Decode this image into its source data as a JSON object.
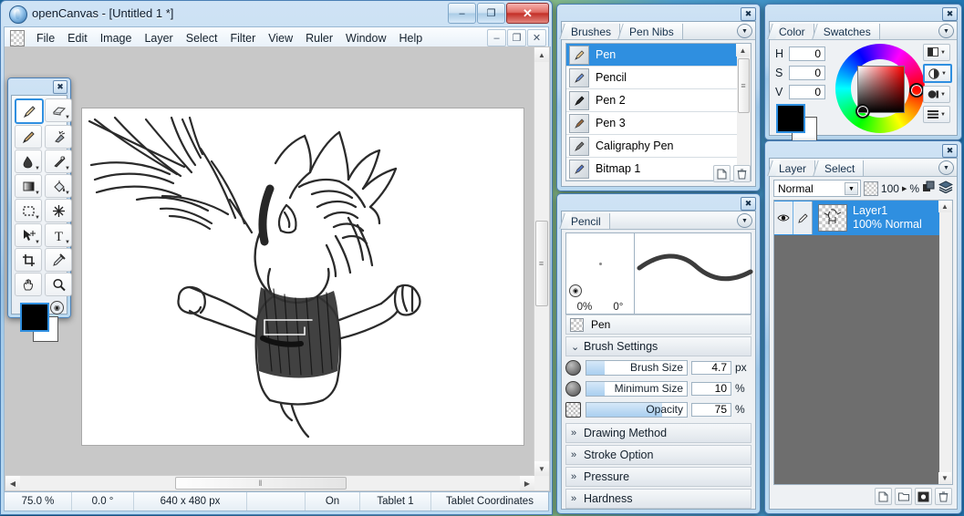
{
  "app": {
    "title": "openCanvas - [Untitled 1 *]",
    "icon": "opencanvas-logo-icon"
  },
  "window_buttons": {
    "minimize": "–",
    "maximize": "❐",
    "close": "✕"
  },
  "mdi_buttons": {
    "minimize": "–",
    "restore": "❐",
    "close": "✕"
  },
  "menu": {
    "items": [
      {
        "label": "File"
      },
      {
        "label": "Edit"
      },
      {
        "label": "Image"
      },
      {
        "label": "Layer"
      },
      {
        "label": "Select"
      },
      {
        "label": "Filter"
      },
      {
        "label": "View"
      },
      {
        "label": "Ruler"
      },
      {
        "label": "Window"
      },
      {
        "label": "Help"
      }
    ]
  },
  "toolbox": {
    "close": "✖",
    "tools": [
      {
        "name": "pencil-tool",
        "icon": "pencil-icon",
        "selected": true,
        "arrow": false
      },
      {
        "name": "eraser-tool",
        "icon": "eraser-icon",
        "selected": false,
        "arrow": true
      },
      {
        "name": "brush-tool",
        "icon": "brush-icon",
        "selected": false,
        "arrow": false
      },
      {
        "name": "airbrush-tool",
        "icon": "airbrush-icon",
        "selected": false,
        "arrow": false
      },
      {
        "name": "blur-tool",
        "icon": "waterdrop-icon",
        "selected": false,
        "arrow": true
      },
      {
        "name": "smudge-tool",
        "icon": "smudge-icon",
        "selected": false,
        "arrow": true
      },
      {
        "name": "gradient-tool",
        "icon": "gradient-icon",
        "selected": false,
        "arrow": true
      },
      {
        "name": "fill-tool",
        "icon": "paint-bucket-icon",
        "selected": false,
        "arrow": true
      },
      {
        "name": "marquee-select-tool",
        "icon": "marquee-icon",
        "selected": false,
        "arrow": true
      },
      {
        "name": "magic-wand-tool",
        "icon": "magic-wand-icon",
        "selected": false,
        "arrow": false
      },
      {
        "name": "move-tool",
        "icon": "move-arrow-icon",
        "selected": false,
        "arrow": true
      },
      {
        "name": "text-tool",
        "icon": "text-t-icon",
        "selected": false,
        "arrow": true
      },
      {
        "name": "crop-tool",
        "icon": "crop-icon",
        "selected": false,
        "arrow": false
      },
      {
        "name": "eyedropper-tool",
        "icon": "eyedropper-icon",
        "selected": false,
        "arrow": false
      },
      {
        "name": "hand-tool",
        "icon": "hand-icon",
        "selected": false,
        "arrow": false
      },
      {
        "name": "zoom-tool",
        "icon": "magnifier-icon",
        "selected": false,
        "arrow": false
      }
    ],
    "foreground_color": "#000000",
    "background_color": "#ffffff",
    "swap_icon": "swap-colors-icon"
  },
  "status_bar": {
    "zoom": "75.0 %",
    "rotation": "0.0 °",
    "size": "640 x 480 px",
    "blank": "",
    "tablet_state": "On",
    "tablet_name": "Tablet 1",
    "coordinates_mode": "Tablet Coordinates"
  },
  "brushes_panel": {
    "close": "✖",
    "tabs": [
      {
        "label": "Brushes",
        "active": true
      },
      {
        "label": "Pen Nibs",
        "active": false
      }
    ],
    "menu_icon": "chevron-down-icon",
    "items": [
      {
        "label": "Pen",
        "selected": true
      },
      {
        "label": "Pencil",
        "selected": false
      },
      {
        "label": "Pen 2",
        "selected": false
      },
      {
        "label": "Pen 3",
        "selected": false
      },
      {
        "label": "Caligraphy Pen",
        "selected": false
      },
      {
        "label": "Bitmap 1",
        "selected": false
      }
    ],
    "buttons": [
      {
        "name": "new-brush-button",
        "icon": "new-page-icon"
      },
      {
        "name": "delete-brush-button",
        "icon": "trash-icon"
      }
    ]
  },
  "brush_settings_panel": {
    "close": "✖",
    "tabs": [
      {
        "label": "Pencil",
        "active": true
      }
    ],
    "menu_icon": "chevron-down-icon",
    "preview": {
      "scatter": "0%",
      "angle": "0°",
      "knob_icon": "resize-handle-icon"
    },
    "current_brush": "Pen",
    "sections": [
      {
        "label": "Brush Settings",
        "expanded": true,
        "chevron": "»"
      },
      {
        "label": "Drawing Method",
        "expanded": false,
        "chevron": "»"
      },
      {
        "label": "Stroke Option",
        "expanded": false,
        "chevron": "»"
      },
      {
        "label": "Pressure",
        "expanded": false,
        "chevron": "»"
      },
      {
        "label": "Hardness",
        "expanded": false,
        "chevron": "»"
      }
    ],
    "sliders": [
      {
        "label": "Brush Size",
        "value": "4.7",
        "unit": "px",
        "fill_pct": 18,
        "icon": "circle-knob-icon"
      },
      {
        "label": "Minimum Size",
        "value": "10",
        "unit": "%",
        "fill_pct": 18,
        "icon": "circle-knob-icon"
      },
      {
        "label": "Opacity",
        "value": "75",
        "unit": "%",
        "fill_pct": 75,
        "icon": "checker-knob-icon"
      }
    ]
  },
  "color_panel": {
    "close": "✖",
    "tabs": [
      {
        "label": "Color",
        "active": true
      },
      {
        "label": "Swatches",
        "active": false
      }
    ],
    "menu_icon": "chevron-down-icon",
    "fields": [
      {
        "label": "H",
        "value": "0"
      },
      {
        "label": "S",
        "value": "0"
      },
      {
        "label": "V",
        "value": "0"
      }
    ],
    "foreground_color": "#000000",
    "background_color": "#ffffff",
    "modes": [
      {
        "name": "color-mode-bar",
        "icon": "square-gradient-icon",
        "selected": false
      },
      {
        "name": "color-mode-wheel",
        "icon": "color-wheel-icon",
        "selected": true
      },
      {
        "name": "color-mode-circle",
        "icon": "filled-circle-icon",
        "selected": false
      },
      {
        "name": "color-mode-sliders",
        "icon": "sliders-icon",
        "selected": false
      }
    ]
  },
  "layer_panel": {
    "close": "✖",
    "tabs": [
      {
        "label": "Layer",
        "active": true
      },
      {
        "label": "Select",
        "active": false
      }
    ],
    "menu_icon": "chevron-down-icon",
    "blend_mode": "Normal",
    "opacity": "100",
    "opacity_unit": "%",
    "header_icons": [
      {
        "name": "alpha-lock-icon",
        "icon": "checker-icon"
      },
      {
        "name": "clipping-icon",
        "icon": "layers-clip-icon"
      },
      {
        "name": "layer-stack-icon",
        "icon": "stack-icon"
      }
    ],
    "layers": [
      {
        "name": "Layer1",
        "info": "100% Normal",
        "selected": true,
        "visible": true
      }
    ],
    "buttons": [
      {
        "name": "new-layer-button",
        "icon": "new-page-icon"
      },
      {
        "name": "new-folder-button",
        "icon": "folder-icon"
      },
      {
        "name": "add-mask-button",
        "icon": "mask-icon"
      },
      {
        "name": "delete-layer-button",
        "icon": "trash-icon"
      }
    ]
  },
  "canvas": {
    "artwork_description": "pencil sketch of a spiky-haired character with raised fists",
    "h_scroll_grip": "‖",
    "v_scroll_grip": "≡"
  }
}
